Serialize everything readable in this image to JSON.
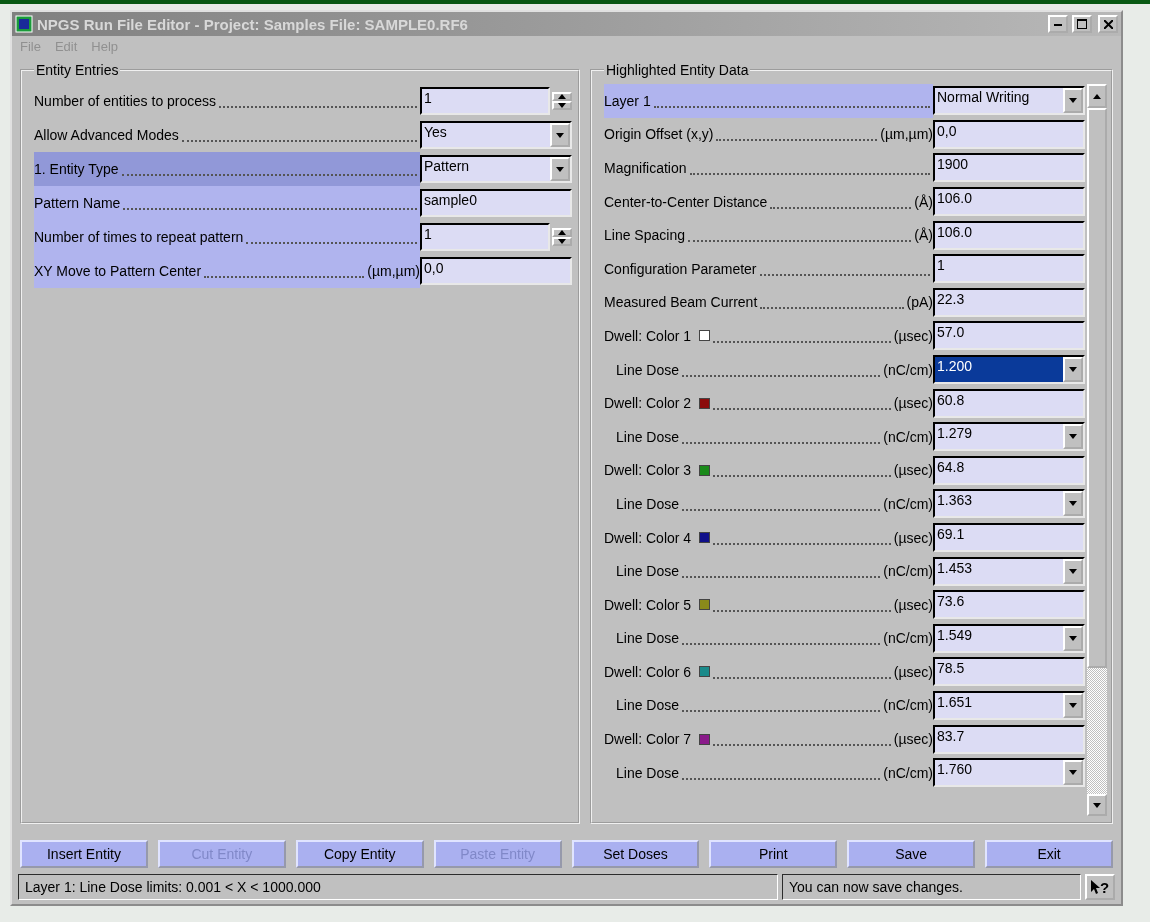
{
  "window": {
    "title": "NPGS Run File Editor - Project: Samples  File: SAMPLE0.RF6"
  },
  "menu": [
    {
      "label": "File",
      "disabled": true
    },
    {
      "label": "Edit",
      "disabled": true
    },
    {
      "label": "Help",
      "disabled": true
    }
  ],
  "entity_entries": {
    "title": "Entity Entries",
    "rows": [
      {
        "label": "Number of entities to process",
        "value": "1",
        "kind": "spin",
        "highlighted": false,
        "focused": false
      },
      {
        "label": "Allow Advanced Modes",
        "value": "Yes",
        "kind": "select",
        "highlighted": false,
        "focused": false
      },
      {
        "label": "1. Entity Type",
        "value": "Pattern",
        "kind": "select",
        "highlighted": true,
        "focused": true
      },
      {
        "label": "Pattern Name",
        "value": "sample0",
        "kind": "text",
        "highlighted": true,
        "focused": false
      },
      {
        "label": "Number of times to repeat pattern",
        "value": "1",
        "kind": "spin",
        "highlighted": true,
        "focused": false
      },
      {
        "label": "XY Move to Pattern Center",
        "unit": "(µm,µm)",
        "value": "0,0",
        "kind": "text",
        "highlighted": true,
        "focused": false
      }
    ]
  },
  "entity_data": {
    "title": "Highlighted Entity Data",
    "rows": [
      {
        "label": "Layer  1",
        "value": "Normal Writing",
        "kind": "select",
        "highlighted": true,
        "focused": false
      },
      {
        "label": "Origin Offset (x,y)",
        "unit": "(µm,µm)",
        "value": "0,0",
        "kind": "text",
        "highlighted": false,
        "focused": false
      },
      {
        "label": "Magnification",
        "value": "1900",
        "kind": "text",
        "highlighted": false,
        "focused": false
      },
      {
        "label": "Center-to-Center Distance",
        "unit": "(Å)",
        "value": "106.0",
        "kind": "text",
        "highlighted": false,
        "focused": false
      },
      {
        "label": "Line Spacing",
        "unit": "(Å)",
        "value": "106.0",
        "kind": "text",
        "highlighted": false,
        "focused": false
      },
      {
        "label": "Configuration Parameter",
        "value": "1",
        "kind": "text",
        "highlighted": false,
        "focused": false
      },
      {
        "label": "Measured Beam Current",
        "unit": "(pA)",
        "value": "22.3",
        "kind": "text",
        "highlighted": false,
        "focused": false
      },
      {
        "label": "Dwell: Color 1",
        "color": "#ffffff",
        "unit": "(µsec)",
        "value": "57.0",
        "kind": "text",
        "highlighted": false,
        "focused": false
      },
      {
        "label": "Line Dose",
        "unit": "(nC/cm)",
        "value": "1.200",
        "kind": "dose",
        "highlighted": false,
        "focused": false,
        "selected": true
      },
      {
        "label": "Dwell: Color 2",
        "color": "#8b0c0c",
        "unit": "(µsec)",
        "value": "60.8",
        "kind": "text",
        "highlighted": false,
        "focused": false
      },
      {
        "label": "Line Dose",
        "unit": "(nC/cm)",
        "value": "1.279",
        "kind": "dose",
        "highlighted": false,
        "focused": false,
        "selected": false
      },
      {
        "label": "Dwell: Color 3",
        "color": "#1a8a1a",
        "unit": "(µsec)",
        "value": "64.8",
        "kind": "text",
        "highlighted": false,
        "focused": false
      },
      {
        "label": "Line Dose",
        "unit": "(nC/cm)",
        "value": "1.363",
        "kind": "dose",
        "highlighted": false,
        "focused": false,
        "selected": false
      },
      {
        "label": "Dwell: Color 4",
        "color": "#10108a",
        "unit": "(µsec)",
        "value": "69.1",
        "kind": "text",
        "highlighted": false,
        "focused": false
      },
      {
        "label": "Line Dose",
        "unit": "(nC/cm)",
        "value": "1.453",
        "kind": "dose",
        "highlighted": false,
        "focused": false,
        "selected": false
      },
      {
        "label": "Dwell: Color 5",
        "color": "#8a8a1a",
        "unit": "(µsec)",
        "value": "73.6",
        "kind": "text",
        "highlighted": false,
        "focused": false
      },
      {
        "label": "Line Dose",
        "unit": "(nC/cm)",
        "value": "1.549",
        "kind": "dose",
        "highlighted": false,
        "focused": false,
        "selected": false
      },
      {
        "label": "Dwell: Color 6",
        "color": "#1a8a8a",
        "unit": "(µsec)",
        "value": "78.5",
        "kind": "text",
        "highlighted": false,
        "focused": false
      },
      {
        "label": "Line Dose",
        "unit": "(nC/cm)",
        "value": "1.651",
        "kind": "dose",
        "highlighted": false,
        "focused": false,
        "selected": false
      },
      {
        "label": "Dwell: Color 7",
        "color": "#8a1a8a",
        "unit": "(µsec)",
        "value": "83.7",
        "kind": "text",
        "highlighted": false,
        "focused": false
      },
      {
        "label": "Line Dose",
        "unit": "(nC/cm)",
        "value": "1.760",
        "kind": "dose",
        "highlighted": false,
        "focused": false,
        "selected": false
      }
    ]
  },
  "buttons": [
    {
      "label": "Insert Entity",
      "disabled": false
    },
    {
      "label": "Cut Entity",
      "disabled": true
    },
    {
      "label": "Copy Entity",
      "disabled": false
    },
    {
      "label": "Paste Entity",
      "disabled": true
    },
    {
      "label": "Set Doses",
      "disabled": false
    },
    {
      "label": "Print",
      "disabled": false
    },
    {
      "label": "Save",
      "disabled": false
    },
    {
      "label": "Exit",
      "disabled": false
    }
  ],
  "status_bar": {
    "left": "Layer 1:   Line Dose limits: 0.001 < X < 1000.000",
    "right": "You can now save changes.",
    "help_button": "?"
  }
}
